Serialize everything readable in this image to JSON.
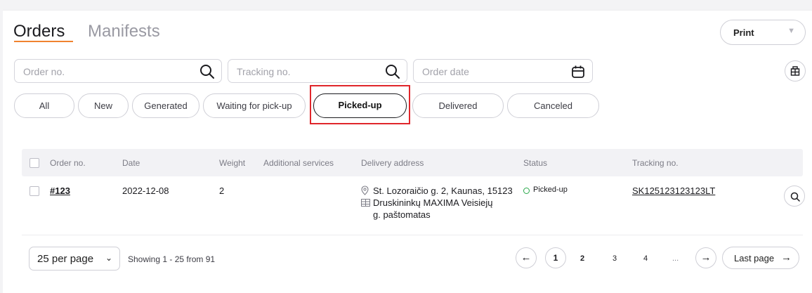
{
  "tabs": {
    "orders": "Orders",
    "manifests": "Manifests"
  },
  "print": {
    "label": "Print"
  },
  "filters": {
    "order_no_placeholder": "Order no.",
    "tracking_placeholder": "Tracking no.",
    "date_placeholder": "Order date"
  },
  "status_chips": [
    "All",
    "New",
    "Generated",
    "Waiting for pick-up",
    "Picked-up",
    "Delivered",
    "Canceled"
  ],
  "active_chip": "Picked-up",
  "table": {
    "headers": {
      "order_no": "Order no.",
      "date": "Date",
      "weight": "Weight",
      "additional_services": "Additional services",
      "delivery_address": "Delivery address",
      "status": "Status",
      "tracking_no": "Tracking no."
    },
    "rows": [
      {
        "order_no": "#123",
        "date": "2022-12-08",
        "weight": "2",
        "additional_services": "",
        "address": "St. Lozoraičio g. 2, Kaunas, 15123",
        "terminal_line1": "Druskininkų MAXIMA Veisiejų",
        "terminal_line2": "g. paštomatas",
        "status": "Picked-up",
        "tracking_no": "SK125123123123LT"
      }
    ]
  },
  "pagination": {
    "per_page": "25 per page",
    "showing": "Showing 1 - 25 from 91",
    "pages": [
      "1",
      "2",
      "3",
      "4",
      "..."
    ],
    "current": "1",
    "prev_arrow": "←",
    "next_arrow": "→",
    "last_page": "Last page"
  },
  "colors": {
    "accent": "#f0832f",
    "status_green": "#2aa84a",
    "highlight": "#e0262b"
  },
  "icons": [
    "search-icon",
    "calendar-icon",
    "kiosk-icon",
    "location-pin-icon",
    "parcel-locker-icon",
    "magnifier-icon"
  ]
}
